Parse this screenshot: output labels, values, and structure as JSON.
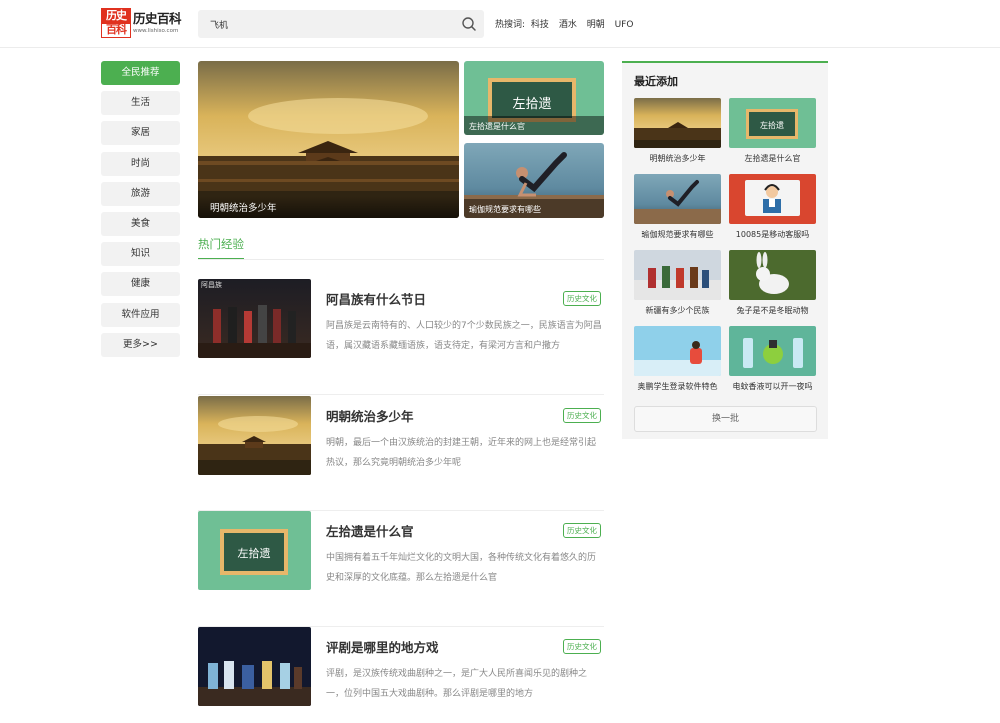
{
  "brand": {
    "badge_top": "历史",
    "badge_bottom": "百科",
    "name": "历史百科",
    "url": "www.lishiso.com"
  },
  "search": {
    "value": "飞机",
    "placeholder": "飞机"
  },
  "hot_search": {
    "label": "热搜词:",
    "terms": [
      "科技",
      "酒水",
      "明朝",
      "UFO"
    ]
  },
  "nav": {
    "items": [
      "全民推荐",
      "生活",
      "家居",
      "时尚",
      "旅游",
      "美食",
      "知识",
      "健康",
      "软件应用",
      "更多>>"
    ],
    "active": "全民推荐"
  },
  "hero": {
    "main": {
      "caption": "明朝统治多少年"
    },
    "side_top": {
      "caption": "左拾遗是什么官",
      "board_text": "左拾遗"
    },
    "side_bottom": {
      "caption": "瑜伽规范要求有哪些"
    }
  },
  "section": {
    "title": "热门经验"
  },
  "articles": [
    {
      "title": "阿昌族有什么节日",
      "tag": "历史文化",
      "desc": "阿昌族是云南特有的、人口较少的7个少数民族之一，民族语言为阿昌语，属汉藏语系藏缅语族，语支待定，有梁河方言和户撒方",
      "thumb_label": "阿昌族"
    },
    {
      "title": "明朝统治多少年",
      "tag": "历史文化",
      "desc": "明朝，最后一个由汉族统治的封建王朝，近年来的网上也是经常引起热议，那么究竟明朝统治多少年呢"
    },
    {
      "title": "左拾遗是什么官",
      "tag": "历史文化",
      "desc": "中国拥有着五千年灿烂文化的文明大国，各种传统文化有着悠久的历史和深厚的文化底蕴。那么左拾遗是什么官",
      "board_text": "左拾遗"
    },
    {
      "title": "评剧是哪里的地方戏",
      "tag": "历史文化",
      "desc": "评剧，是汉族传统戏曲剧种之一，是广大人民所喜闻乐见的剧种之一，位列中国五大戏曲剧种。那么评剧是哪里的地方"
    }
  ],
  "sidebar": {
    "title": "最近添加",
    "items": [
      {
        "caption": "明朝统治多少年"
      },
      {
        "caption": "左拾遗是什么官",
        "board_text": "左拾遗"
      },
      {
        "caption": "瑜伽规范要求有哪些"
      },
      {
        "caption": "10085是移动客服吗"
      },
      {
        "caption": "新疆有多少个民族"
      },
      {
        "caption": "兔子是不是冬眠动物"
      },
      {
        "caption": "奥鹏学生登录软件特色"
      },
      {
        "caption": "电蚊香液可以开一夜吗"
      }
    ],
    "swap_label": "换一批"
  },
  "colors": {
    "accent": "#4caf50",
    "brand_red": "#e0311f",
    "board_green": "#6fbf95"
  }
}
